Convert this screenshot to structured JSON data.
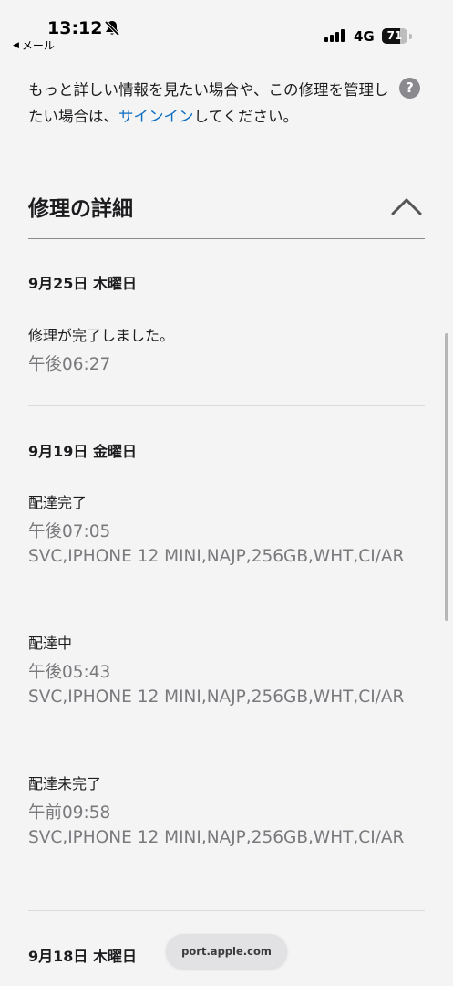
{
  "status_bar": {
    "time": "13:12",
    "back_label": "メール",
    "network": "4G",
    "battery_level": "71",
    "battery_fraction": 0.71
  },
  "info": {
    "text_before": "もっと詳しい情報を見たい場合や、この修理を管理したい場合は、",
    "link_text": "サインイン",
    "text_after": "してください。",
    "help_icon": "?"
  },
  "section": {
    "title": "修理の詳細",
    "expanded_icon": "chevron-up-icon"
  },
  "days": [
    {
      "header": "9月25日 木曜日",
      "events": [
        {
          "title": "修理が完了しました。",
          "time": "午後06:27",
          "desc": ""
        }
      ]
    },
    {
      "header": "9月19日 金曜日",
      "events": [
        {
          "title": "配達完了",
          "time": "午後07:05",
          "desc": "SVC,IPHONE 12 MINI,NAJP,256GB,WHT,CI/AR"
        },
        {
          "title": "配達中",
          "time": "午後05:43",
          "desc": "SVC,IPHONE 12 MINI,NAJP,256GB,WHT,CI/AR"
        },
        {
          "title": "配達未完了",
          "time": "午前09:58",
          "desc": "SVC,IPHONE 12 MINI,NAJP,256GB,WHT,CI/AR"
        }
      ]
    },
    {
      "header": "9月18日 木曜日",
      "events": []
    }
  ],
  "browser": {
    "url": "port.apple.com"
  },
  "colors": {
    "link": "#0a6dc2",
    "muted_text": "#7a7a7e",
    "background": "#f4f4f4"
  }
}
